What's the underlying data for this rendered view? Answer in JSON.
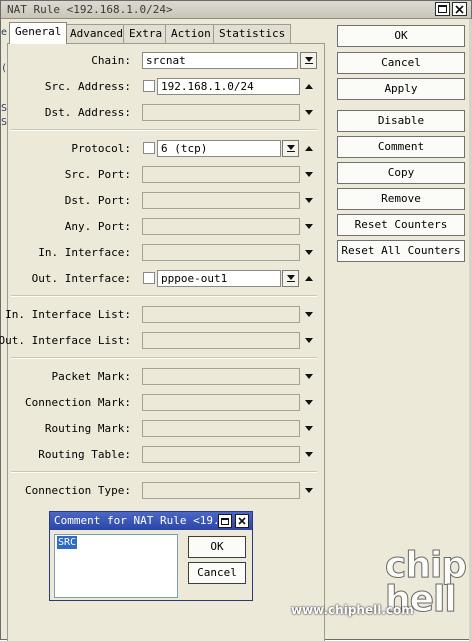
{
  "window": {
    "title": "NAT Rule <192.168.1.0/24>"
  },
  "background_window": {
    "sliver_chars": [
      "e",
      "(",
      "S",
      "S"
    ]
  },
  "tabs": [
    {
      "label": "General",
      "active": true
    },
    {
      "label": "Advanced",
      "active": false
    },
    {
      "label": "Extra",
      "active": false
    },
    {
      "label": "Action",
      "active": false
    },
    {
      "label": "Statistics",
      "active": false
    }
  ],
  "form": {
    "chain": {
      "label": "Chain:",
      "value": "srcnat"
    },
    "src_address": {
      "label": "Src. Address:",
      "value": "192.168.1.0/24"
    },
    "dst_address": {
      "label": "Dst. Address:",
      "value": ""
    },
    "protocol": {
      "label": "Protocol:",
      "value": "6 (tcp)"
    },
    "src_port": {
      "label": "Src. Port:",
      "value": ""
    },
    "dst_port": {
      "label": "Dst. Port:",
      "value": ""
    },
    "any_port": {
      "label": "Any. Port:",
      "value": ""
    },
    "in_interface": {
      "label": "In. Interface:",
      "value": ""
    },
    "out_interface": {
      "label": "Out. Interface:",
      "value": "pppoe-out1"
    },
    "in_interface_list": {
      "label": "In. Interface List:",
      "value": ""
    },
    "out_interface_list": {
      "label": "Out. Interface List:",
      "value": ""
    },
    "packet_mark": {
      "label": "Packet Mark:",
      "value": ""
    },
    "connection_mark": {
      "label": "Connection Mark:",
      "value": ""
    },
    "routing_mark": {
      "label": "Routing Mark:",
      "value": ""
    },
    "routing_table": {
      "label": "Routing Table:",
      "value": ""
    },
    "connection_type": {
      "label": "Connection Type:",
      "value": ""
    }
  },
  "buttons": {
    "ok": "OK",
    "cancel": "Cancel",
    "apply": "Apply",
    "disable": "Disable",
    "comment": "Comment",
    "copy": "Copy",
    "remove": "Remove",
    "reset_counters": "Reset Counters",
    "reset_all_counters": "Reset All Counters"
  },
  "comment_dialog": {
    "title": "Comment for NAT Rule <19...",
    "text": "SRC",
    "ok": "OK",
    "cancel": "Cancel"
  },
  "watermark": {
    "logo": "chip hell",
    "url": "www.chiphell.com"
  },
  "colors": {
    "window_bg": "#ece9d8",
    "dialog_title": "#2b45a5",
    "selection": "#316ac5"
  }
}
